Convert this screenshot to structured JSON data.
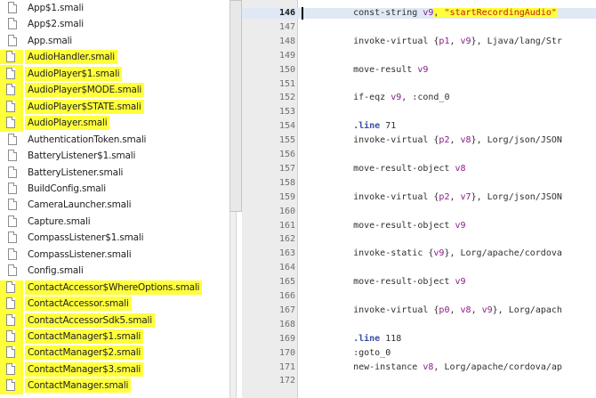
{
  "files": [
    {
      "name": "App$1.smali",
      "highlighted": false
    },
    {
      "name": "App$2.smali",
      "highlighted": false
    },
    {
      "name": "App.smali",
      "highlighted": false
    },
    {
      "name": "AudioHandler.smali",
      "highlighted": true
    },
    {
      "name": "AudioPlayer$1.smali",
      "highlighted": true
    },
    {
      "name": "AudioPlayer$MODE.smali",
      "highlighted": true
    },
    {
      "name": "AudioPlayer$STATE.smali",
      "highlighted": true
    },
    {
      "name": "AudioPlayer.smali",
      "highlighted": true
    },
    {
      "name": "AuthenticationToken.smali",
      "highlighted": false
    },
    {
      "name": "BatteryListener$1.smali",
      "highlighted": false
    },
    {
      "name": "BatteryListener.smali",
      "highlighted": false
    },
    {
      "name": "BuildConfig.smali",
      "highlighted": false
    },
    {
      "name": "CameraLauncher.smali",
      "highlighted": false
    },
    {
      "name": "Capture.smali",
      "highlighted": false
    },
    {
      "name": "CompassListener$1.smali",
      "highlighted": false
    },
    {
      "name": "CompassListener.smali",
      "highlighted": false
    },
    {
      "name": "Config.smali",
      "highlighted": false
    },
    {
      "name": "ContactAccessor$WhereOptions.smali",
      "highlighted": true
    },
    {
      "name": "ContactAccessor.smali",
      "highlighted": true
    },
    {
      "name": "ContactAccessorSdk5.smali",
      "highlighted": true
    },
    {
      "name": "ContactManager$1.smali",
      "highlighted": true
    },
    {
      "name": "ContactManager$2.smali",
      "highlighted": true
    },
    {
      "name": "ContactManager$3.smali",
      "highlighted": true
    },
    {
      "name": "ContactManager.smali",
      "highlighted": true
    }
  ],
  "editor": {
    "current_line": "146",
    "lines": [
      {
        "n": "146",
        "text": "    const-string v9, ",
        "str": "\"startRecordingAudio\""
      },
      {
        "n": "147",
        "text": ""
      },
      {
        "n": "148",
        "text": "    invoke-virtual {p1, v9}, Ljava/lang/Str"
      },
      {
        "n": "149",
        "text": ""
      },
      {
        "n": "150",
        "text": "    move-result v9"
      },
      {
        "n": "151",
        "text": ""
      },
      {
        "n": "152",
        "text": "    if-eqz v9, :cond_0"
      },
      {
        "n": "153",
        "text": ""
      },
      {
        "n": "154",
        "text": "    .line 71"
      },
      {
        "n": "155",
        "text": "    invoke-virtual {p2, v8}, Lorg/json/JSON"
      },
      {
        "n": "156",
        "text": ""
      },
      {
        "n": "157",
        "text": "    move-result-object v8"
      },
      {
        "n": "158",
        "text": ""
      },
      {
        "n": "159",
        "text": "    invoke-virtual {p2, v7}, Lorg/json/JSON"
      },
      {
        "n": "160",
        "text": ""
      },
      {
        "n": "161",
        "text": "    move-result-object v9"
      },
      {
        "n": "162",
        "text": ""
      },
      {
        "n": "163",
        "text": "    invoke-static {v9}, Lorg/apache/cordova"
      },
      {
        "n": "164",
        "text": ""
      },
      {
        "n": "165",
        "text": "    move-result-object v9"
      },
      {
        "n": "166",
        "text": ""
      },
      {
        "n": "167",
        "text": "    invoke-virtual {p0, v8, v9}, Lorg/apach"
      },
      {
        "n": "168",
        "text": ""
      },
      {
        "n": "169",
        "text": "    .line 118"
      },
      {
        "n": "170",
        "text": "    :goto_0"
      },
      {
        "n": "171",
        "text": "    new-instance v8, Lorg/apache/cordova/ap"
      },
      {
        "n": "172",
        "text": ""
      }
    ]
  },
  "colors": {
    "highlight": "#ffff3b",
    "current_line_bg": "#dfe9f5",
    "gutter_bg": "#ececec",
    "register": "#8b1a8b",
    "string": "#c41a16",
    "directive": "#3a4fa8"
  }
}
